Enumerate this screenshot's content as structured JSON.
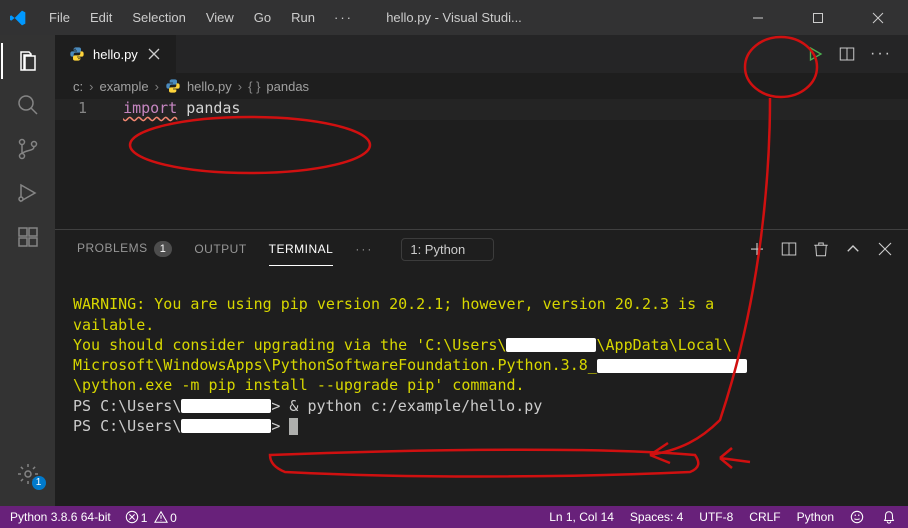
{
  "titlebar": {
    "menu": [
      "File",
      "Edit",
      "Selection",
      "View",
      "Go",
      "Run"
    ],
    "title": "hello.py - Visual Studi..."
  },
  "activity": {
    "settings_badge": "1"
  },
  "tabs": {
    "open": [
      {
        "label": "hello.py"
      }
    ]
  },
  "breadcrumb": {
    "parts": [
      "c:",
      "example",
      "hello.py",
      "pandas"
    ],
    "braces": "{ }"
  },
  "editor": {
    "lines": [
      {
        "num": "1",
        "kw": "import",
        "rest": " pandas"
      }
    ]
  },
  "panel": {
    "tabs": {
      "problems": "PROBLEMS",
      "problems_count": "1",
      "output": "OUTPUT",
      "terminal": "TERMINAL"
    },
    "terminal_select": "1: Python",
    "terminal_lines": {
      "l1": "WARNING: You are using pip version 20.2.1; however, version 20.2.3 is a",
      "l2": "vailable.",
      "l3a": "You should consider upgrading via the 'C:\\Users\\",
      "l3b": "\\AppData\\Local\\",
      "l4a": "Microsoft\\WindowsApps\\PythonSoftwareFoundation.Python.3.8_",
      "l5": "\\python.exe -m pip install --upgrade pip' command.",
      "l6a": "PS C:\\Users\\",
      "l6b": "> & python c:/example/hello.py",
      "l7a": "PS C:\\Users\\",
      "l7b": "> "
    }
  },
  "status": {
    "left": {
      "python": "Python 3.8.6 64-bit",
      "err": "1",
      "warn": "0"
    },
    "right": {
      "ln": "Ln 1, Col 14",
      "spaces": "Spaces: 4",
      "enc": "UTF-8",
      "eol": "CRLF",
      "lang": "Python"
    }
  }
}
